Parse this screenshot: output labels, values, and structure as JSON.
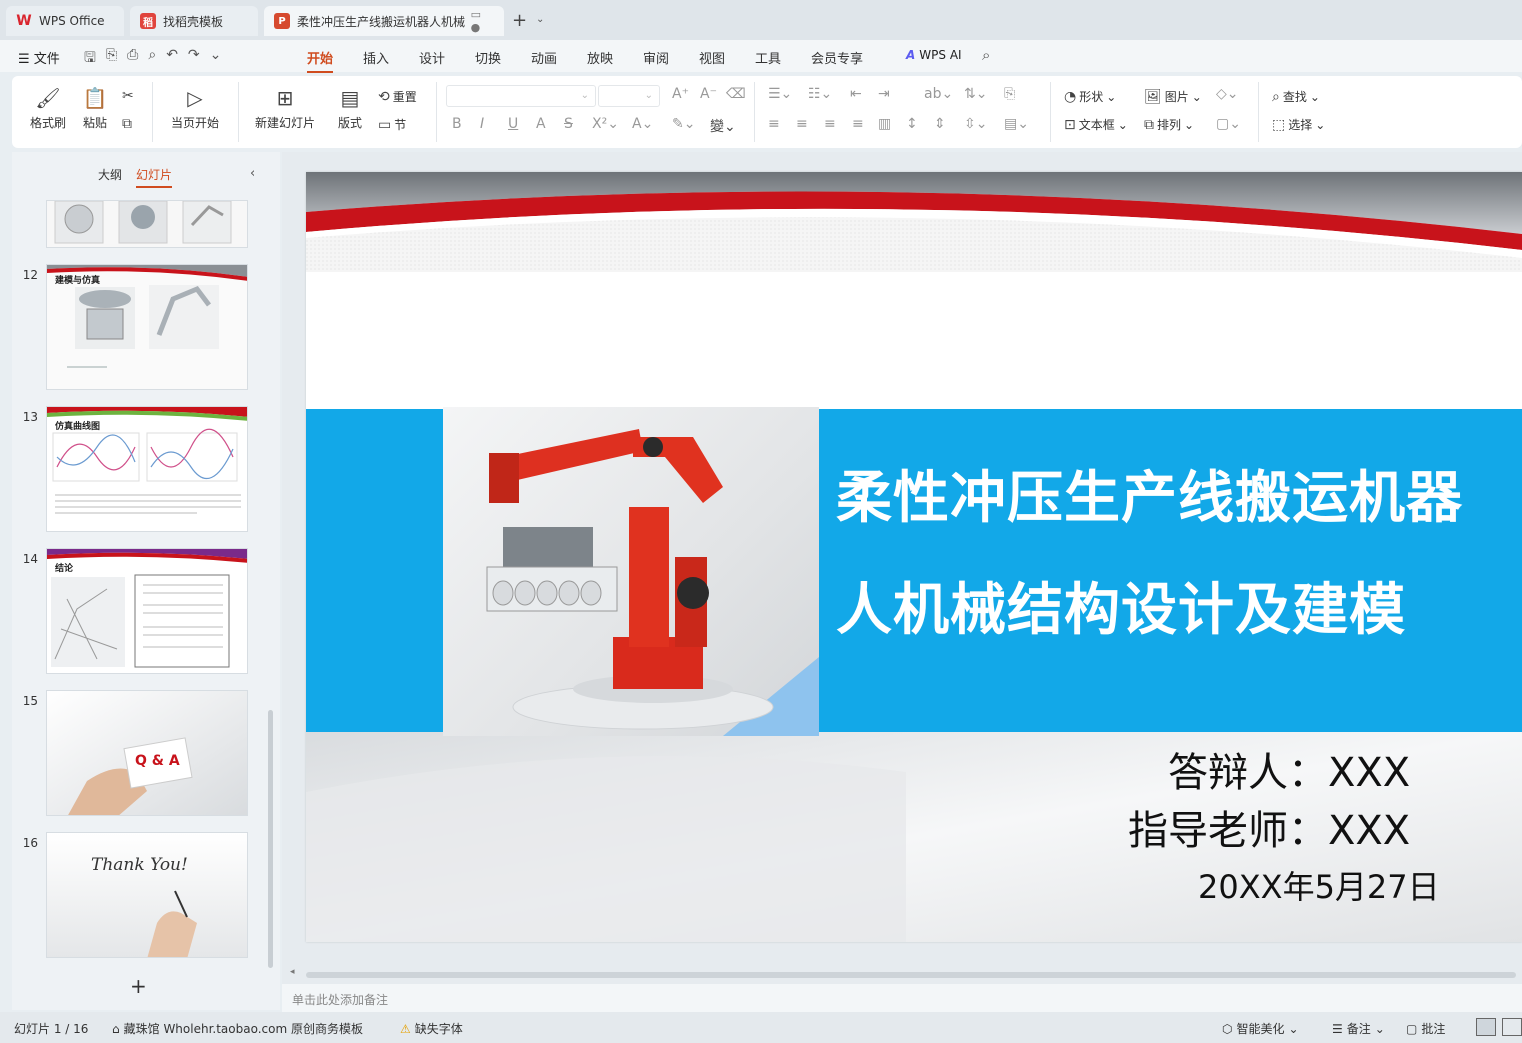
{
  "tabs": {
    "wps": "WPS Office",
    "template": "找稻壳模板",
    "document": "柔性冲压生产线搬运机器人机械"
  },
  "menu": {
    "file": "文件",
    "items": [
      "开始",
      "插入",
      "设计",
      "切换",
      "动画",
      "放映",
      "审阅",
      "视图",
      "工具",
      "会员专享"
    ],
    "ai": "WPS AI"
  },
  "ribbon": {
    "format_painter": "格式刷",
    "paste": "粘贴",
    "play_from_current": "当页开始",
    "new_slide": "新建幻灯片",
    "layout": "版式",
    "reset": "重置",
    "section": "节",
    "shape": "形状",
    "picture": "图片",
    "textbox": "文本框",
    "arrange": "排列",
    "find": "查找",
    "select": "选择"
  },
  "left_pane": {
    "tab_outline": "大纲",
    "tab_slides": "幻灯片",
    "thumbnails": [
      {
        "num": "12",
        "title": "建模与仿真"
      },
      {
        "num": "13",
        "title": "仿真曲线图"
      },
      {
        "num": "14",
        "title": "结论"
      },
      {
        "num": "15",
        "title": "Q & A"
      },
      {
        "num": "16",
        "title": "Thank You!"
      }
    ]
  },
  "slide": {
    "title_line1": "柔性冲压生产线搬运机器",
    "title_line2": "人机械结构设计及建模",
    "defender": "答辩人：XXX",
    "advisor": "指导老师：XXX",
    "date": "20XX年5月27日"
  },
  "notes_placeholder": "单击此处添加备注",
  "status": {
    "slide_counter": "幻灯片 1 / 16",
    "shop": "藏珠馆 Wholehr.taobao.com 原创商务模板",
    "missing_font": "缺失字体",
    "beautify": "智能美化",
    "notes": "备注",
    "comments": "批注"
  },
  "colors": {
    "accent": "#d04c1f",
    "slide_blue": "#12a8e8",
    "slide_red": "#c8131b"
  }
}
